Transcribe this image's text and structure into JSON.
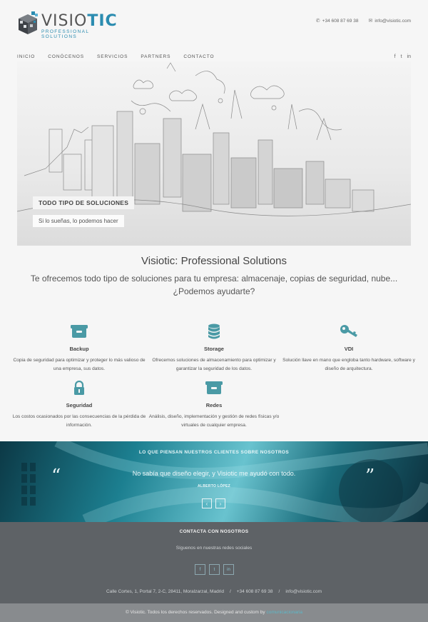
{
  "brand": {
    "name_part1": "VISIO",
    "name_part2": "TIC",
    "tagline": "PROFESSIONAL SOLUTIONS"
  },
  "header": {
    "phone_icon": "phone-icon",
    "phone": "+34 608 87 69 38",
    "email_icon": "envelope-icon",
    "email": "info@visiotic.com"
  },
  "nav": {
    "items": [
      "INICIO",
      "CONÓCENOS",
      "SERVICIOS",
      "PARTNERS",
      "CONTACTO"
    ]
  },
  "social_top": [
    "f",
    "t",
    "in"
  ],
  "hero": {
    "title": "TODO TIPO DE SOLUCIONES",
    "subtitle": "Si lo sueñas, lo podemos hacer"
  },
  "intro": {
    "title": "Visiotic: Professional Solutions",
    "subtitle": "Te ofrecemos todo tipo de soluciones para tu empresa: almacenaje, copias de seguridad, nube... ¿Podemos ayudarte?"
  },
  "features": [
    {
      "icon": "archive-box-icon",
      "title": "Backup",
      "desc": "Copia de seguridad para optimizar y proteger lo más valioso de una empresa, sus datos."
    },
    {
      "icon": "database-icon",
      "title": "Storage",
      "desc": "Ofrecemos soluciones de almacenamiento para optimizar y garantizar la seguridad de los datos."
    },
    {
      "icon": "key-icon",
      "title": "VDI",
      "desc": "Solución llave en mano que engloba tanto hardware, software y diseño de arquitectura."
    },
    {
      "icon": "padlock-icon",
      "title": "Seguridad",
      "desc": "Los costos ocasionados por las consecuencias de la pérdida de información."
    },
    {
      "icon": "archive-box-icon",
      "title": "Redes",
      "desc": "Análisis, diseño, implementación y gestión de redes físicas y/o virtuales de cualquier empresa."
    }
  ],
  "testimonial": {
    "title": "LO QUE PIENSAN NUESTROS CLIENTES SOBRE NOSOTROS",
    "quote": "No sabía que diseño elegir, y Visiotic me ayudó con todo.",
    "author": "ALBERTO LÓPEZ",
    "open_quote": "“",
    "close_quote": "”",
    "prev": "‹",
    "next": "›"
  },
  "footer": {
    "title": "CONTACTA CON NOSOTROS",
    "subtitle": "Síguenos en nuestras redes sociales",
    "social": [
      "f",
      "t",
      "in"
    ],
    "address": "Calle Cortes, 1, Portal 7, 2-C, 28411, Moralzarzal, Madrid",
    "phone": "+34 608 87 69 38",
    "email": "info@visiotic.com",
    "separator": "/"
  },
  "bottom": {
    "text": "© Visiotic. Todos los derechos reservados. Designed and custom by",
    "link": "comunicacionaria"
  },
  "colors": {
    "accent": "#4a9aa5",
    "brand_blue": "#2b8cb0",
    "footer_bg": "#5e6266",
    "bottom_bg": "#888b8e"
  }
}
